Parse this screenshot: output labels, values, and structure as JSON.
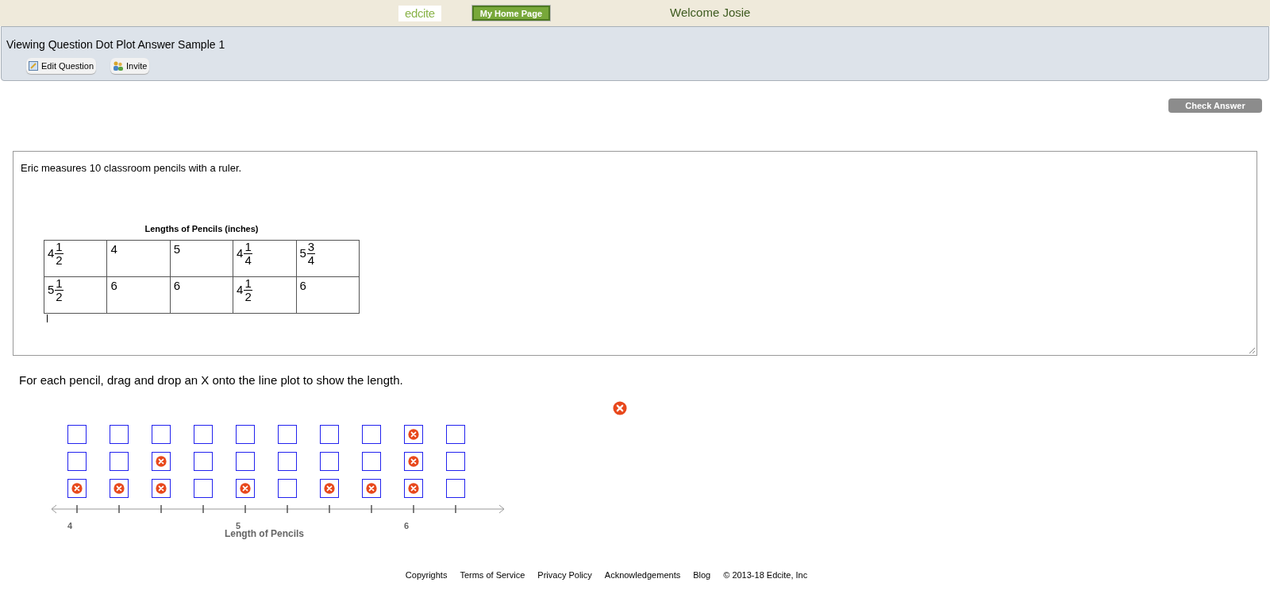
{
  "header": {
    "logo": "edcite",
    "home_button": "My Home Page",
    "welcome": "Welcome Josie"
  },
  "toolbar": {
    "title": "Viewing Question Dot Plot Answer Sample 1",
    "buttons": [
      {
        "kind": "edit",
        "label": "Edit Question"
      },
      {
        "kind": "invite",
        "label": "Invite"
      }
    ]
  },
  "check_button": "Check Answer",
  "question": {
    "text": "Eric measures 10 classroom pencils with a ruler.",
    "table_title": "Lengths of Pencils (inches)",
    "rows": [
      [
        {
          "whole": "4",
          "num": "1",
          "den": "2"
        },
        {
          "whole": "4"
        },
        {
          "whole": "5"
        },
        {
          "whole": "4",
          "num": "1",
          "den": "4"
        },
        {
          "whole": "5",
          "num": "3",
          "den": "4"
        }
      ],
      [
        {
          "whole": "5",
          "num": "1",
          "den": "2"
        },
        {
          "whole": "6"
        },
        {
          "whole": "6"
        },
        {
          "whole": "4",
          "num": "1",
          "den": "2"
        },
        {
          "whole": "6"
        }
      ]
    ]
  },
  "instruction": "For each pencil, drag and drop an X onto the line plot to show the length.",
  "plot": {
    "xlabel": "Length of Pencils",
    "columns": [
      {
        "tick_label": "4",
        "slots": [
          true,
          false,
          false
        ]
      },
      {
        "slots": [
          true,
          false,
          false
        ]
      },
      {
        "slots": [
          true,
          true,
          false
        ]
      },
      {
        "slots": [
          false,
          false,
          false
        ]
      },
      {
        "tick_label": "5",
        "slots": [
          true,
          false,
          false
        ]
      },
      {
        "slots": [
          false,
          false,
          false
        ]
      },
      {
        "slots": [
          true,
          false,
          false
        ]
      },
      {
        "slots": [
          true,
          false,
          false
        ]
      },
      {
        "tick_label": "6",
        "slots": [
          true,
          true,
          true
        ]
      },
      {
        "slots": [
          false,
          false,
          false
        ]
      }
    ]
  },
  "footer": {
    "links": [
      "Copyrights",
      "Terms of Service",
      "Privacy Policy",
      "Acknowledgements",
      "Blog"
    ],
    "copyright": "© 2013-18 Edcite, Inc"
  }
}
